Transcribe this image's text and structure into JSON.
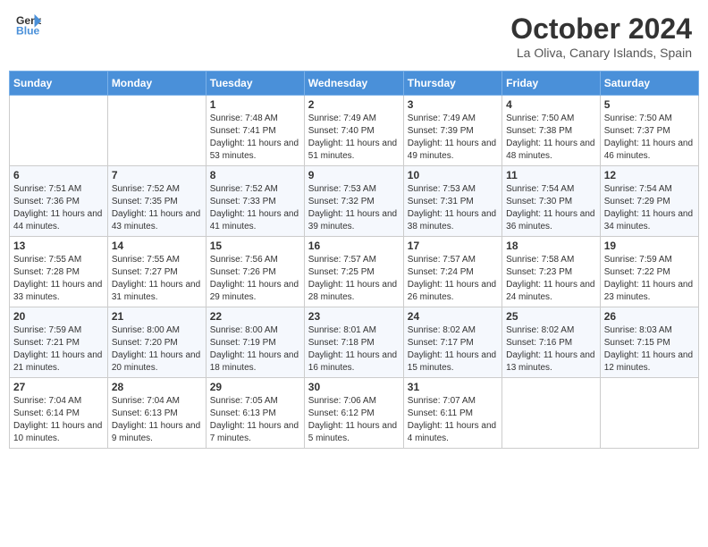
{
  "header": {
    "logo_line1": "General",
    "logo_line2": "Blue",
    "month": "October 2024",
    "location": "La Oliva, Canary Islands, Spain"
  },
  "days_of_week": [
    "Sunday",
    "Monday",
    "Tuesday",
    "Wednesday",
    "Thursday",
    "Friday",
    "Saturday"
  ],
  "weeks": [
    [
      {
        "day": "",
        "sunrise": "",
        "sunset": "",
        "daylight": ""
      },
      {
        "day": "",
        "sunrise": "",
        "sunset": "",
        "daylight": ""
      },
      {
        "day": "1",
        "sunrise": "Sunrise: 7:48 AM",
        "sunset": "Sunset: 7:41 PM",
        "daylight": "Daylight: 11 hours and 53 minutes."
      },
      {
        "day": "2",
        "sunrise": "Sunrise: 7:49 AM",
        "sunset": "Sunset: 7:40 PM",
        "daylight": "Daylight: 11 hours and 51 minutes."
      },
      {
        "day": "3",
        "sunrise": "Sunrise: 7:49 AM",
        "sunset": "Sunset: 7:39 PM",
        "daylight": "Daylight: 11 hours and 49 minutes."
      },
      {
        "day": "4",
        "sunrise": "Sunrise: 7:50 AM",
        "sunset": "Sunset: 7:38 PM",
        "daylight": "Daylight: 11 hours and 48 minutes."
      },
      {
        "day": "5",
        "sunrise": "Sunrise: 7:50 AM",
        "sunset": "Sunset: 7:37 PM",
        "daylight": "Daylight: 11 hours and 46 minutes."
      }
    ],
    [
      {
        "day": "6",
        "sunrise": "Sunrise: 7:51 AM",
        "sunset": "Sunset: 7:36 PM",
        "daylight": "Daylight: 11 hours and 44 minutes."
      },
      {
        "day": "7",
        "sunrise": "Sunrise: 7:52 AM",
        "sunset": "Sunset: 7:35 PM",
        "daylight": "Daylight: 11 hours and 43 minutes."
      },
      {
        "day": "8",
        "sunrise": "Sunrise: 7:52 AM",
        "sunset": "Sunset: 7:33 PM",
        "daylight": "Daylight: 11 hours and 41 minutes."
      },
      {
        "day": "9",
        "sunrise": "Sunrise: 7:53 AM",
        "sunset": "Sunset: 7:32 PM",
        "daylight": "Daylight: 11 hours and 39 minutes."
      },
      {
        "day": "10",
        "sunrise": "Sunrise: 7:53 AM",
        "sunset": "Sunset: 7:31 PM",
        "daylight": "Daylight: 11 hours and 38 minutes."
      },
      {
        "day": "11",
        "sunrise": "Sunrise: 7:54 AM",
        "sunset": "Sunset: 7:30 PM",
        "daylight": "Daylight: 11 hours and 36 minutes."
      },
      {
        "day": "12",
        "sunrise": "Sunrise: 7:54 AM",
        "sunset": "Sunset: 7:29 PM",
        "daylight": "Daylight: 11 hours and 34 minutes."
      }
    ],
    [
      {
        "day": "13",
        "sunrise": "Sunrise: 7:55 AM",
        "sunset": "Sunset: 7:28 PM",
        "daylight": "Daylight: 11 hours and 33 minutes."
      },
      {
        "day": "14",
        "sunrise": "Sunrise: 7:55 AM",
        "sunset": "Sunset: 7:27 PM",
        "daylight": "Daylight: 11 hours and 31 minutes."
      },
      {
        "day": "15",
        "sunrise": "Sunrise: 7:56 AM",
        "sunset": "Sunset: 7:26 PM",
        "daylight": "Daylight: 11 hours and 29 minutes."
      },
      {
        "day": "16",
        "sunrise": "Sunrise: 7:57 AM",
        "sunset": "Sunset: 7:25 PM",
        "daylight": "Daylight: 11 hours and 28 minutes."
      },
      {
        "day": "17",
        "sunrise": "Sunrise: 7:57 AM",
        "sunset": "Sunset: 7:24 PM",
        "daylight": "Daylight: 11 hours and 26 minutes."
      },
      {
        "day": "18",
        "sunrise": "Sunrise: 7:58 AM",
        "sunset": "Sunset: 7:23 PM",
        "daylight": "Daylight: 11 hours and 24 minutes."
      },
      {
        "day": "19",
        "sunrise": "Sunrise: 7:59 AM",
        "sunset": "Sunset: 7:22 PM",
        "daylight": "Daylight: 11 hours and 23 minutes."
      }
    ],
    [
      {
        "day": "20",
        "sunrise": "Sunrise: 7:59 AM",
        "sunset": "Sunset: 7:21 PM",
        "daylight": "Daylight: 11 hours and 21 minutes."
      },
      {
        "day": "21",
        "sunrise": "Sunrise: 8:00 AM",
        "sunset": "Sunset: 7:20 PM",
        "daylight": "Daylight: 11 hours and 20 minutes."
      },
      {
        "day": "22",
        "sunrise": "Sunrise: 8:00 AM",
        "sunset": "Sunset: 7:19 PM",
        "daylight": "Daylight: 11 hours and 18 minutes."
      },
      {
        "day": "23",
        "sunrise": "Sunrise: 8:01 AM",
        "sunset": "Sunset: 7:18 PM",
        "daylight": "Daylight: 11 hours and 16 minutes."
      },
      {
        "day": "24",
        "sunrise": "Sunrise: 8:02 AM",
        "sunset": "Sunset: 7:17 PM",
        "daylight": "Daylight: 11 hours and 15 minutes."
      },
      {
        "day": "25",
        "sunrise": "Sunrise: 8:02 AM",
        "sunset": "Sunset: 7:16 PM",
        "daylight": "Daylight: 11 hours and 13 minutes."
      },
      {
        "day": "26",
        "sunrise": "Sunrise: 8:03 AM",
        "sunset": "Sunset: 7:15 PM",
        "daylight": "Daylight: 11 hours and 12 minutes."
      }
    ],
    [
      {
        "day": "27",
        "sunrise": "Sunrise: 7:04 AM",
        "sunset": "Sunset: 6:14 PM",
        "daylight": "Daylight: 11 hours and 10 minutes."
      },
      {
        "day": "28",
        "sunrise": "Sunrise: 7:04 AM",
        "sunset": "Sunset: 6:13 PM",
        "daylight": "Daylight: 11 hours and 9 minutes."
      },
      {
        "day": "29",
        "sunrise": "Sunrise: 7:05 AM",
        "sunset": "Sunset: 6:13 PM",
        "daylight": "Daylight: 11 hours and 7 minutes."
      },
      {
        "day": "30",
        "sunrise": "Sunrise: 7:06 AM",
        "sunset": "Sunset: 6:12 PM",
        "daylight": "Daylight: 11 hours and 5 minutes."
      },
      {
        "day": "31",
        "sunrise": "Sunrise: 7:07 AM",
        "sunset": "Sunset: 6:11 PM",
        "daylight": "Daylight: 11 hours and 4 minutes."
      },
      {
        "day": "",
        "sunrise": "",
        "sunset": "",
        "daylight": ""
      },
      {
        "day": "",
        "sunrise": "",
        "sunset": "",
        "daylight": ""
      }
    ]
  ]
}
